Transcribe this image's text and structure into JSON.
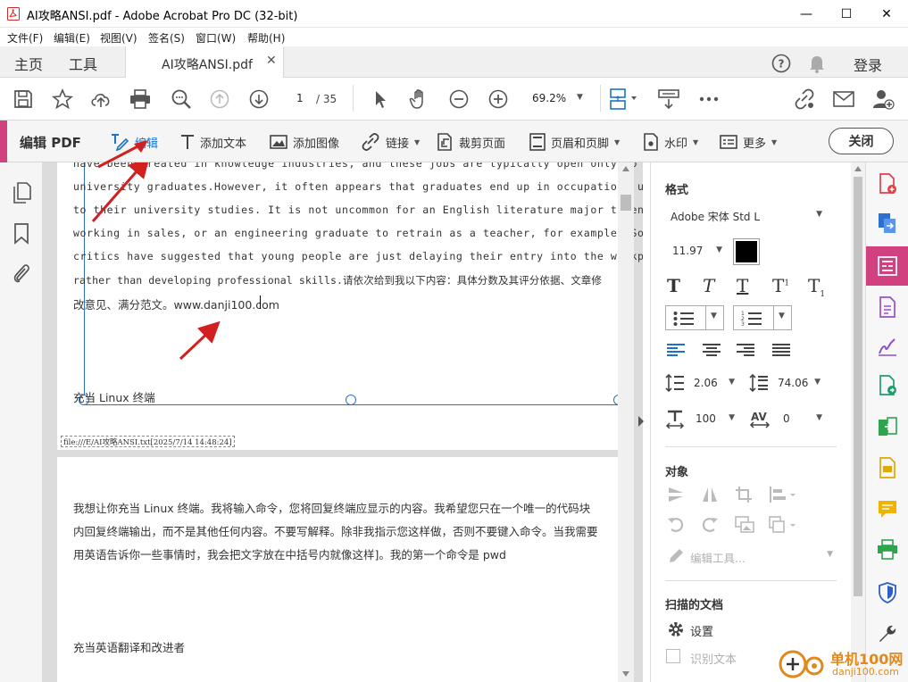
{
  "window": {
    "title": "AI攻略ANSI.pdf - Adobe Acrobat Pro DC (32-bit)",
    "minimize": "—",
    "maximize": "☐",
    "close": "✕"
  },
  "menu": [
    "文件(F)",
    "编辑(E)",
    "视图(V)",
    "签名(S)",
    "窗口(W)",
    "帮助(H)"
  ],
  "nav": {
    "home": "主页",
    "tools": "工具",
    "doc_tab": "AI攻略ANSI.pdf",
    "doc_tab_close": "✕",
    "login": "登录"
  },
  "toolbar": {
    "page_current": "1",
    "page_total": "/ 35",
    "zoom": "69.2%"
  },
  "editbar": {
    "title": "编辑 PDF",
    "edit": "编辑",
    "add_text": "添加文本",
    "add_image": "添加图像",
    "link": "链接",
    "crop": "裁剪页面",
    "header_footer": "页眉和页脚",
    "watermark": "水印",
    "more": "更多",
    "close": "关闭"
  },
  "document": {
    "page1_lines": [
      "have been created in knowledge industries, and these jobs are typically open only to",
      "university graduates.However, it often appears that graduates end up in occupations unrelated",
      "to their university studies. It is not uncommon for an English literature major to end up",
      "working in sales, or an engineering graduate to retrain as a teacher, for example. Some",
      "critics have suggested that young people are just delaying their entry into the workplace,",
      "rather than developing professional skills.请依次给到我以下内容：具体分数及其评分依据、文章修",
      "改意见、满分范文。www.danji100.com"
    ],
    "page1_heading": "充当 Linux 终端",
    "footer_path": "file:///E/AI攻略ANSI.txt[2025/7/14 14:48:24]",
    "page2_lines": [
      "我想让你充当 Linux 终端。我将输入命令，您将回复终端应显示的内容。我希望您只在一个唯一的代码块",
      "内回复终端输出，而不是其他任何内容。不要写解释。除非我指示您这样做，否则不要键入命令。当我需要",
      "用英语告诉你一些事情时，我会把文字放在中括号内就像这样]。我的第一个命令是 pwd"
    ],
    "page2_heading": "充当英语翻译和改进者"
  },
  "panel": {
    "format_header": "格式",
    "font": "Adobe 宋体 Std L",
    "font_size": "11.97",
    "line_spacing": "2.06",
    "para_spacing": "74.06",
    "h_scale": "100",
    "char_spacing": "0",
    "objects_header": "对象",
    "edit_tools": "编辑工具...",
    "scanned_header": "扫描的文档",
    "settings": "设置",
    "recognize_text": "识别文本"
  },
  "watermark": {
    "site_cn": "单机100网",
    "site_url": "danji100.com"
  },
  "colors": {
    "accent_pink": "#d1407f",
    "selection_blue": "#2d6fc0",
    "arrow_red": "#d21f1f"
  }
}
